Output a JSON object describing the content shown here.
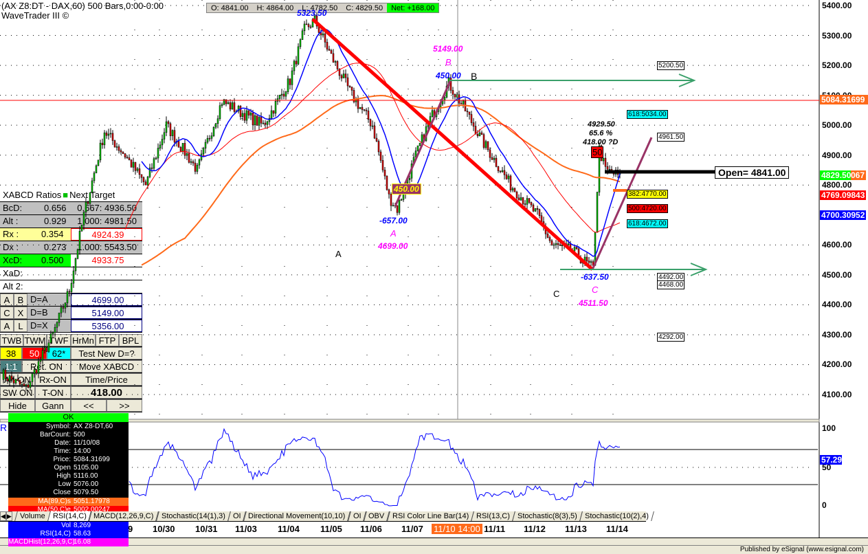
{
  "header": {
    "title": "(AX Z8:DT - DAX,60) 500 Bars,0:00-0:00",
    "subtitle": "WaveTrader III ©",
    "ohlc": {
      "open": "O: 4841.00",
      "high": "H: 4864.00",
      "low": "L: 4782.50",
      "close": "C: 4829.50",
      "net": "Net: +168.00"
    }
  },
  "colors": {
    "up": "#00c000",
    "down": "#e00000",
    "ma_fast": "#0000ff",
    "ma50": "#ff0000",
    "ma89": "#ff6a1a",
    "abcd": "#ff0000",
    "leg": "#993366",
    "arrow": "#3aa06a"
  },
  "price_axis": {
    "ticks": [
      "5400.00",
      "5300.00",
      "5200.00",
      "5100.00",
      "5000.00",
      "4900.00",
      "4800.00",
      "4600.00",
      "4500.00",
      "4400.00",
      "4300.00",
      "4200.00",
      "4100.00"
    ],
    "tags": {
      "ma89": "5084.31699",
      "last": "4829.50",
      "last_suffix": "067",
      "ma50": "4769.09843",
      "ma_fast": "4700.30952"
    }
  },
  "rsi_axis": {
    "ticks": [
      "100",
      "50",
      "0"
    ],
    "value": "57.29"
  },
  "dates": [
    "9",
    "10/30",
    "10/31",
    "11/03",
    "11/04",
    "11/05",
    "11/06",
    "11/07",
    "11/10 14:00",
    "11/11",
    "11/12",
    "11/13",
    "11/14"
  ],
  "chart_data": {
    "type": "candlestick",
    "price_range": [
      4080,
      5420
    ],
    "waypoints": [
      [
        0,
        4170
      ],
      [
        12,
        4120
      ],
      [
        25,
        4300
      ],
      [
        33,
        4450
      ],
      [
        40,
        4700
      ],
      [
        50,
        4980
      ],
      [
        60,
        4900
      ],
      [
        70,
        4800
      ],
      [
        80,
        5000
      ],
      [
        95,
        4850
      ],
      [
        107,
        5080
      ],
      [
        127,
        5000
      ],
      [
        140,
        5150
      ],
      [
        147,
        5320
      ],
      [
        152,
        5350
      ],
      [
        160,
        5230
      ],
      [
        170,
        5100
      ],
      [
        180,
        5000
      ],
      [
        188,
        4760
      ],
      [
        192,
        4720
      ],
      [
        200,
        4880
      ],
      [
        208,
        5020
      ],
      [
        217,
        5140
      ],
      [
        225,
        5050
      ],
      [
        233,
        4950
      ],
      [
        247,
        4800
      ],
      [
        260,
        4700
      ],
      [
        267,
        4600
      ],
      [
        277,
        4580
      ],
      [
        287,
        4520
      ],
      [
        290,
        4920
      ],
      [
        293,
        4850
      ],
      [
        300,
        4830
      ]
    ]
  },
  "annotations": {
    "top_price": "5323.50",
    "b_price": "5149.00",
    "b_letter": "B",
    "b_ret": "450.00",
    "b_label": "B",
    "a_ret": "-657.00",
    "a_letter": "A",
    "a_price": "4699.00",
    "a_label": "A",
    "box_450": "450.00",
    "c_ret": "-637.50",
    "c_letter": "C",
    "c_price": "4511.50",
    "c_label": "C",
    "d_price": "4929.50",
    "d_pct": "65.6 %",
    "d_dist": "418.00 ?D",
    "d_badge": "50",
    "target_5200": "5200.50",
    "fib_618_up": "618:5034.00",
    "target_4961": "4961.50",
    "open_box": "Open= 4841.00",
    "fib_382": "382:4770.00",
    "fib_500": "500:4720.00",
    "fib_618": "618:4672.00",
    "lvl_4492": "4492.00",
    "lvl_4468": "4468.00",
    "lvl_4292": "4292.00"
  },
  "panel": {
    "header": "XABCD Ratios",
    "next": "Next Target",
    "rows": [
      {
        "k": "BcD:",
        "v": "0.656",
        "t": "0.667: 4936.50"
      },
      {
        "k": "Alt  :",
        "v": "0.929",
        "t": "1.000: 4981.50"
      },
      {
        "k": "Rx   :",
        "v": "0.354",
        "t": "4924.39"
      },
      {
        "k": "Dx   :",
        "v": "0.273",
        "t": "1.000: 5543.50"
      },
      {
        "k": "XcD:",
        "v": "0.500",
        "t": "4933.75"
      }
    ],
    "xad": "XaD:",
    "alt2": "Alt 2:",
    "grid": [
      {
        "a": "A",
        "b": "B",
        "d": "D=A",
        "v": "4699.00"
      },
      {
        "a": "C",
        "b": "X",
        "d": "D=B",
        "v": "5149.00"
      },
      {
        "a": "A",
        "b": "L",
        "d": "D=X",
        "v": "5356.00"
      }
    ],
    "buttons": {
      "twb": "TWB",
      "twm": "TWM",
      "twf": "TWF",
      "hrmn": "HrMn",
      "ftp": "FTP",
      "bpl": "BPL",
      "f38": "38",
      "f50": "50",
      "f62": "62*",
      "test": "Test New D=?",
      "ratio": "1:1",
      "ret": "Ret. ON",
      "move": "Move XABCD",
      "alt": "Alt-ON",
      "rx": "Rx-ON",
      "timeprice": "Time/Price",
      "sw": "SW ON",
      "t": "T-ON",
      "value": "418.00",
      "hide": "Hide",
      "gann": "Gann",
      "prev": "<<",
      "next": ">>"
    }
  },
  "data_window": {
    "ok": "OK",
    "rows": [
      {
        "k": "Symbol:",
        "v": "AX Z8-DT,60"
      },
      {
        "k": "BarCount:",
        "v": "500"
      },
      {
        "k": "Date:",
        "v": "11/10/08"
      },
      {
        "k": "Time:",
        "v": "14:00"
      },
      {
        "k": "Price:",
        "v": "5084.31699"
      },
      {
        "k": "Open",
        "v": "5105.00"
      },
      {
        "k": "High",
        "v": "5116.00"
      },
      {
        "k": "Low",
        "v": "5076.00"
      },
      {
        "k": "Close",
        "v": "5079.50"
      }
    ],
    "ma89": {
      "k": "MA(89,C)s",
      "v": "5051.17978"
    },
    "ma50": {
      "k": "MA(50,C)e",
      "v": "5002.00247"
    },
    "vol": {
      "k": "Vol",
      "v": "8,269"
    },
    "rsi": {
      "k": "RSI(14,C)",
      "v": "58.63"
    },
    "macd": {
      "k": "MACDHist(12,26,9,C)",
      "v": "16.08"
    }
  },
  "rsi_label": "R",
  "tabs": [
    "Volume",
    "RSI(14,C)",
    "MACD(12,26,9,C)",
    "Stochastic(14(1),3)",
    "OI",
    "Directional Movement(10,10)",
    "OI",
    "OBV",
    "RSI Color Line Bar(14)",
    "RSI(13,C)",
    "Stochastic(8(3),5)",
    "Stochastic(10(2),4)"
  ],
  "status": "Published by eSignal (www.esignal.com)"
}
